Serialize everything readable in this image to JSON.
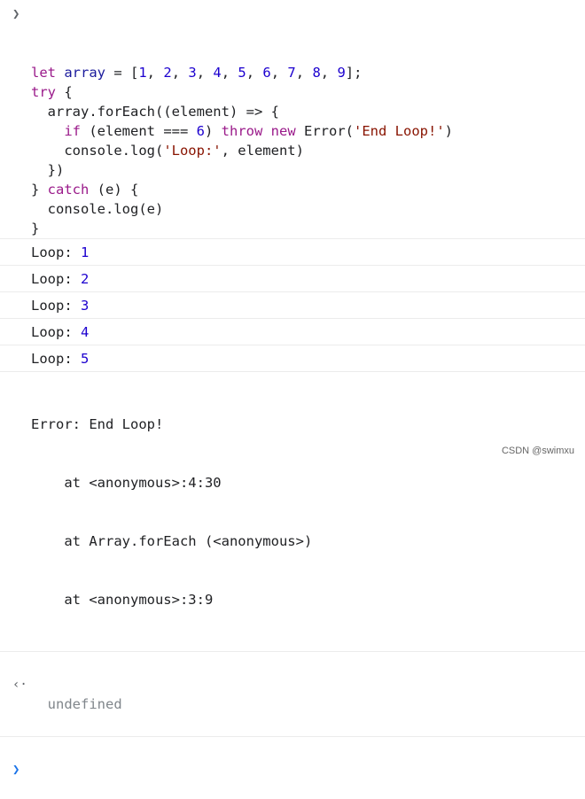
{
  "input": {
    "prompt_icon": "chevron-right-icon",
    "lines": [
      [
        [
          "kw",
          "let "
        ],
        [
          "var",
          "array"
        ],
        [
          "pl",
          " = ["
        ],
        [
          "num",
          "1"
        ],
        [
          "pl",
          ", "
        ],
        [
          "num",
          "2"
        ],
        [
          "pl",
          ", "
        ],
        [
          "num",
          "3"
        ],
        [
          "pl",
          ", "
        ],
        [
          "num",
          "4"
        ],
        [
          "pl",
          ", "
        ],
        [
          "num",
          "5"
        ],
        [
          "pl",
          ", "
        ],
        [
          "num",
          "6"
        ],
        [
          "pl",
          ", "
        ],
        [
          "num",
          "7"
        ],
        [
          "pl",
          ", "
        ],
        [
          "num",
          "8"
        ],
        [
          "pl",
          ", "
        ],
        [
          "num",
          "9"
        ],
        [
          "pl",
          "];"
        ]
      ],
      [
        [
          "kw",
          "try"
        ],
        [
          "pl",
          " {"
        ]
      ],
      [
        [
          "pl",
          "  array.forEach((element) => {"
        ]
      ],
      [
        [
          "pl",
          "    "
        ],
        [
          "kw",
          "if"
        ],
        [
          "pl",
          " (element === "
        ],
        [
          "num",
          "6"
        ],
        [
          "pl",
          ") "
        ],
        [
          "kw",
          "throw new"
        ],
        [
          "pl",
          " Error("
        ],
        [
          "str",
          "'End Loop!'"
        ],
        [
          "pl",
          ")"
        ]
      ],
      [
        [
          "pl",
          "    console.log("
        ],
        [
          "str",
          "'Loop:'"
        ],
        [
          "pl",
          ", element)"
        ]
      ],
      [
        [
          "pl",
          "  })"
        ]
      ],
      [
        [
          "pl",
          "} "
        ],
        [
          "kw",
          "catch"
        ],
        [
          "pl",
          " (e) {"
        ]
      ],
      [
        [
          "pl",
          "  console.log(e)"
        ]
      ],
      [
        [
          "pl",
          "}"
        ]
      ]
    ]
  },
  "logs": [
    {
      "label": "Loop: ",
      "value": "1"
    },
    {
      "label": "Loop: ",
      "value": "2"
    },
    {
      "label": "Loop: ",
      "value": "3"
    },
    {
      "label": "Loop: ",
      "value": "4"
    },
    {
      "label": "Loop: ",
      "value": "5"
    }
  ],
  "error": [
    "Error: End Loop!",
    "    at <anonymous>:4:30",
    "    at Array.forEach (<anonymous>)",
    "    at <anonymous>:3:9"
  ],
  "result": {
    "icon": "return-arrow-icon",
    "value": "undefined"
  },
  "prompt": {
    "icon": "chevron-right-icon"
  },
  "watermark": "CSDN @swimxu"
}
